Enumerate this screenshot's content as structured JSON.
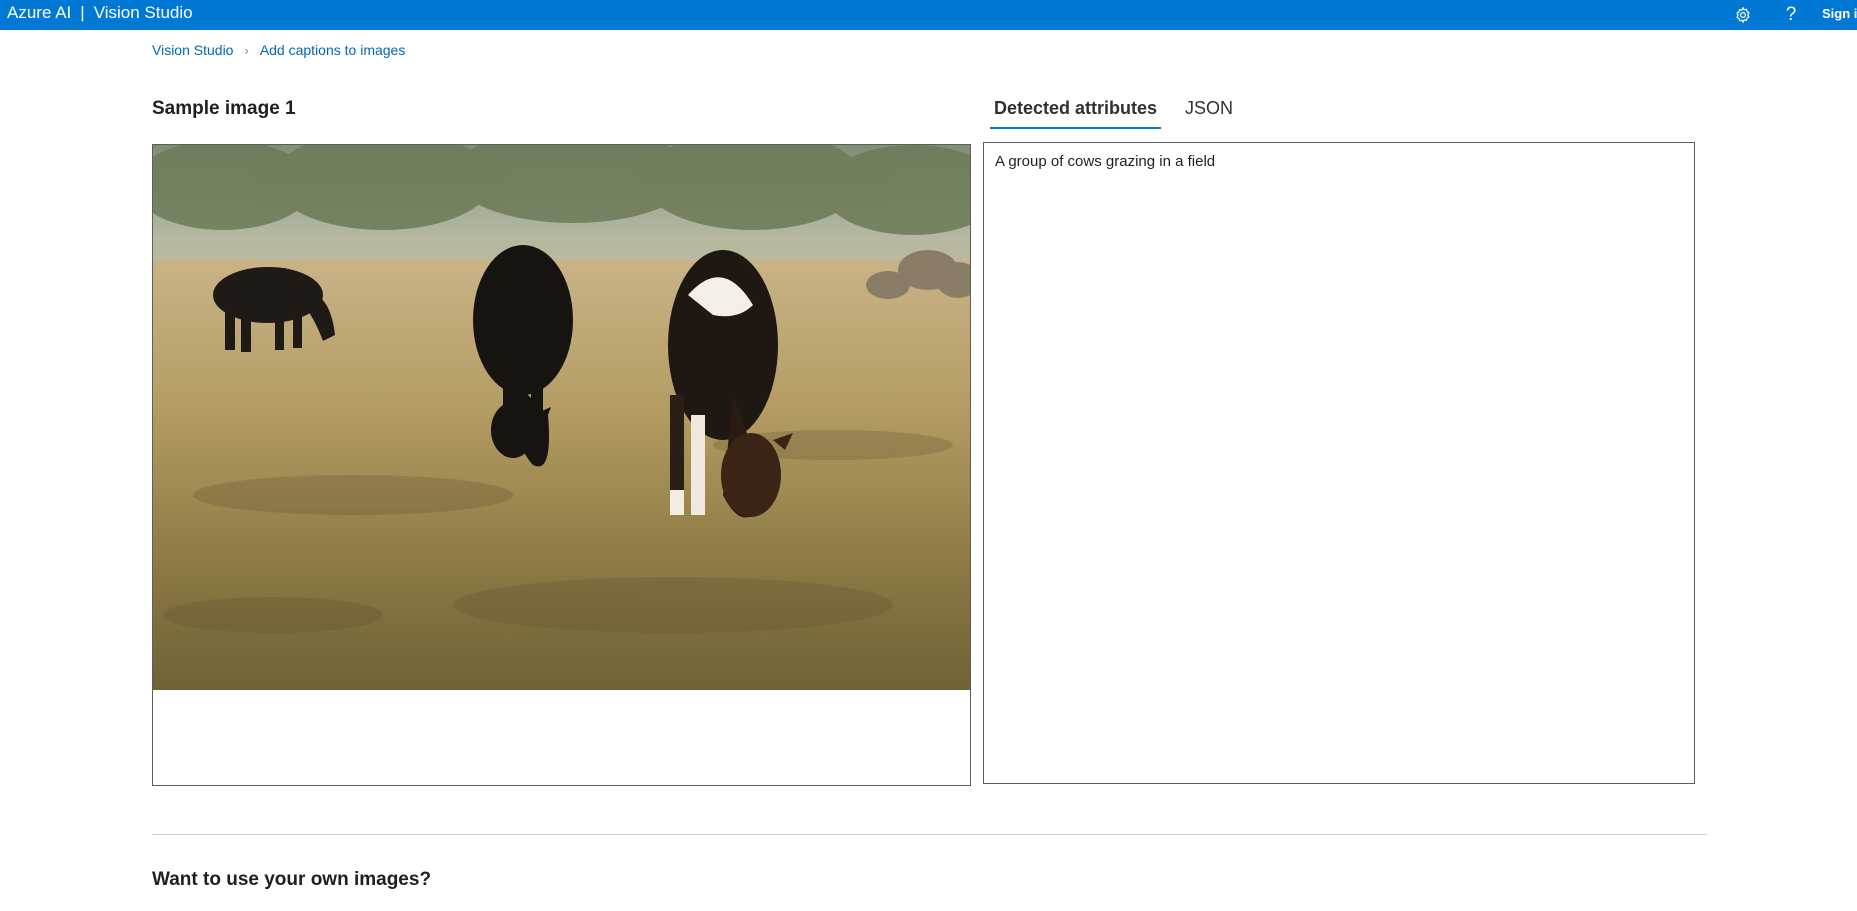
{
  "header": {
    "brand_primary": "Azure AI",
    "brand_separator": "|",
    "brand_secondary": "Vision Studio",
    "settings_icon": "gear-icon",
    "help_icon": "question-icon",
    "signin_label": "Sign in",
    "accent_color": "#0078d4"
  },
  "breadcrumb": {
    "items": [
      {
        "label": "Vision Studio"
      },
      {
        "label": "Add captions to images"
      }
    ],
    "separator_icon": "chevron-right-icon"
  },
  "sample": {
    "title": "Sample image 1"
  },
  "tabs": [
    {
      "label": "Detected attributes",
      "active": true
    },
    {
      "label": "JSON",
      "active": false
    }
  ],
  "result": {
    "caption": "A group of cows grazing in a field"
  },
  "own_images": {
    "title": "Want to use your own images?"
  }
}
